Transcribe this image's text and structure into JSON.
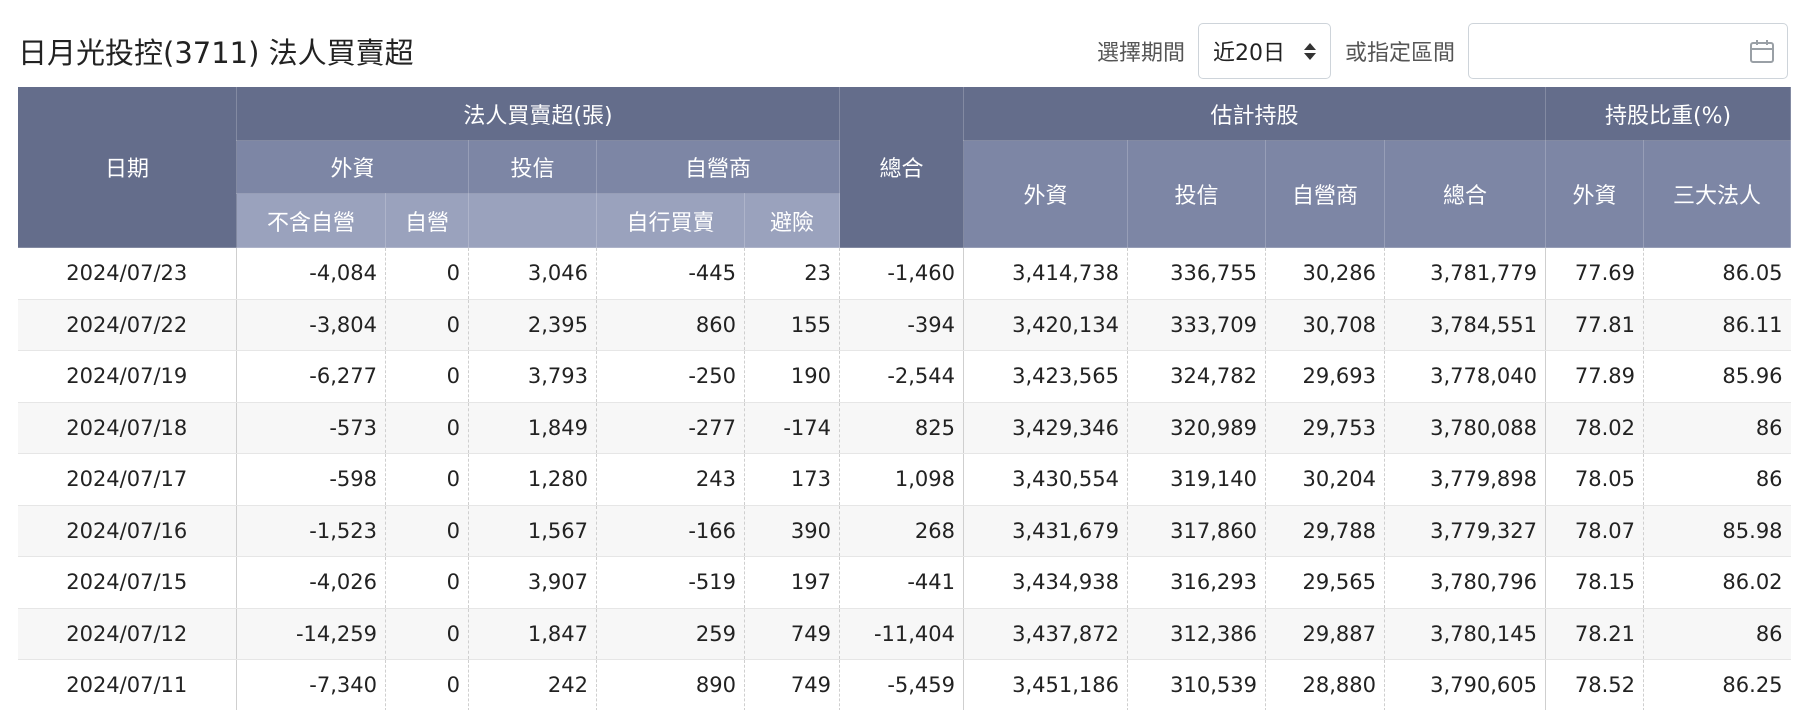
{
  "page": {
    "title": "日月光投控(3711) 法人買賣超"
  },
  "controls": {
    "period_label": "選擇期間",
    "period_value": "近20日",
    "range_label": "或指定區間",
    "range_value": "",
    "range_placeholder": ""
  },
  "colors": {
    "header_dark": "#646d8b",
    "header_light": "#7d86a5",
    "header_lighter": "#9aa2bd",
    "positive": "#d32f2f",
    "negative": "#2e9e2e"
  },
  "table": {
    "headers": {
      "date": "日期",
      "net_group": "法人買賣超(張)",
      "foreign": "外資",
      "foreign_excl": "不含自營",
      "foreign_dealer": "自營",
      "trust": "投信",
      "dealer": "自營商",
      "dealer_self": "自行買賣",
      "dealer_hedge": "避險",
      "total": "總合",
      "holding_group": "估計持股",
      "h_foreign": "外資",
      "h_trust": "投信",
      "h_dealer": "自營商",
      "h_total": "總合",
      "ratio_group": "持股比重(%)",
      "r_foreign": "外資",
      "r_three": "三大法人"
    },
    "rows": [
      {
        "date": "2024/07/23",
        "f_excl": "-4,084",
        "f_dealer": "0",
        "trust": "3,046",
        "d_self": "-445",
        "d_hedge": "23",
        "total": "-1,460",
        "h_foreign": "3,414,738",
        "h_trust": "336,755",
        "h_dealer": "30,286",
        "h_total": "3,781,779",
        "r_foreign": "77.69",
        "r_three": "86.05"
      },
      {
        "date": "2024/07/22",
        "f_excl": "-3,804",
        "f_dealer": "0",
        "trust": "2,395",
        "d_self": "860",
        "d_hedge": "155",
        "total": "-394",
        "h_foreign": "3,420,134",
        "h_trust": "333,709",
        "h_dealer": "30,708",
        "h_total": "3,784,551",
        "r_foreign": "77.81",
        "r_three": "86.11"
      },
      {
        "date": "2024/07/19",
        "f_excl": "-6,277",
        "f_dealer": "0",
        "trust": "3,793",
        "d_self": "-250",
        "d_hedge": "190",
        "total": "-2,544",
        "h_foreign": "3,423,565",
        "h_trust": "324,782",
        "h_dealer": "29,693",
        "h_total": "3,778,040",
        "r_foreign": "77.89",
        "r_three": "85.96"
      },
      {
        "date": "2024/07/18",
        "f_excl": "-573",
        "f_dealer": "0",
        "trust": "1,849",
        "d_self": "-277",
        "d_hedge": "-174",
        "total": "825",
        "h_foreign": "3,429,346",
        "h_trust": "320,989",
        "h_dealer": "29,753",
        "h_total": "3,780,088",
        "r_foreign": "78.02",
        "r_three": "86"
      },
      {
        "date": "2024/07/17",
        "f_excl": "-598",
        "f_dealer": "0",
        "trust": "1,280",
        "d_self": "243",
        "d_hedge": "173",
        "total": "1,098",
        "h_foreign": "3,430,554",
        "h_trust": "319,140",
        "h_dealer": "30,204",
        "h_total": "3,779,898",
        "r_foreign": "78.05",
        "r_three": "86"
      },
      {
        "date": "2024/07/16",
        "f_excl": "-1,523",
        "f_dealer": "0",
        "trust": "1,567",
        "d_self": "-166",
        "d_hedge": "390",
        "total": "268",
        "h_foreign": "3,431,679",
        "h_trust": "317,860",
        "h_dealer": "29,788",
        "h_total": "3,779,327",
        "r_foreign": "78.07",
        "r_three": "85.98"
      },
      {
        "date": "2024/07/15",
        "f_excl": "-4,026",
        "f_dealer": "0",
        "trust": "3,907",
        "d_self": "-519",
        "d_hedge": "197",
        "total": "-441",
        "h_foreign": "3,434,938",
        "h_trust": "316,293",
        "h_dealer": "29,565",
        "h_total": "3,780,796",
        "r_foreign": "78.15",
        "r_three": "86.02"
      },
      {
        "date": "2024/07/12",
        "f_excl": "-14,259",
        "f_dealer": "0",
        "trust": "1,847",
        "d_self": "259",
        "d_hedge": "749",
        "total": "-11,404",
        "h_foreign": "3,437,872",
        "h_trust": "312,386",
        "h_dealer": "29,887",
        "h_total": "3,780,145",
        "r_foreign": "78.21",
        "r_three": "86"
      },
      {
        "date": "2024/07/11",
        "f_excl": "-7,340",
        "f_dealer": "0",
        "trust": "242",
        "d_self": "890",
        "d_hedge": "749",
        "total": "-5,459",
        "h_foreign": "3,451,186",
        "h_trust": "310,539",
        "h_dealer": "28,880",
        "h_total": "3,790,605",
        "r_foreign": "78.52",
        "r_three": "86.25"
      }
    ]
  }
}
